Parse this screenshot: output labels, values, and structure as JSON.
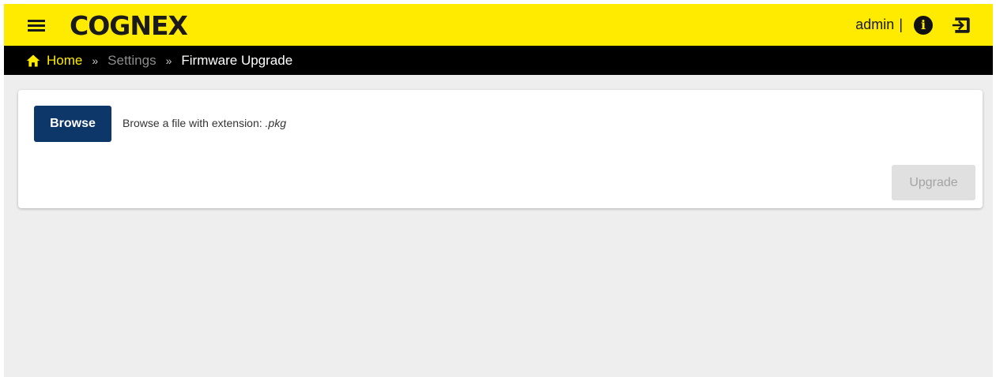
{
  "header": {
    "logo_text": "COGNEX",
    "username": "admin",
    "separator": "|",
    "icons": {
      "menu": "hamburger-menu-icon",
      "info": "info-icon",
      "logout": "logout-icon"
    },
    "colors": {
      "brand_yellow": "#ffeb00",
      "text_dark": "#1a1a1a"
    }
  },
  "breadcrumb": {
    "home": "Home",
    "separator": "»",
    "settings": "Settings",
    "current": "Firmware Upgrade",
    "colors": {
      "background": "#000000",
      "home": "#ffeb00",
      "inactive": "#8c8c8c",
      "current": "#ffffff"
    }
  },
  "card": {
    "browse_label": "Browse",
    "hint_prefix": "Browse a file with extension: ",
    "hint_ext": ".pkg",
    "upgrade_label": "Upgrade",
    "upgrade_disabled": true,
    "colors": {
      "browse_bg": "#0d3669",
      "upgrade_bg_disabled": "#e0e0e0"
    }
  }
}
